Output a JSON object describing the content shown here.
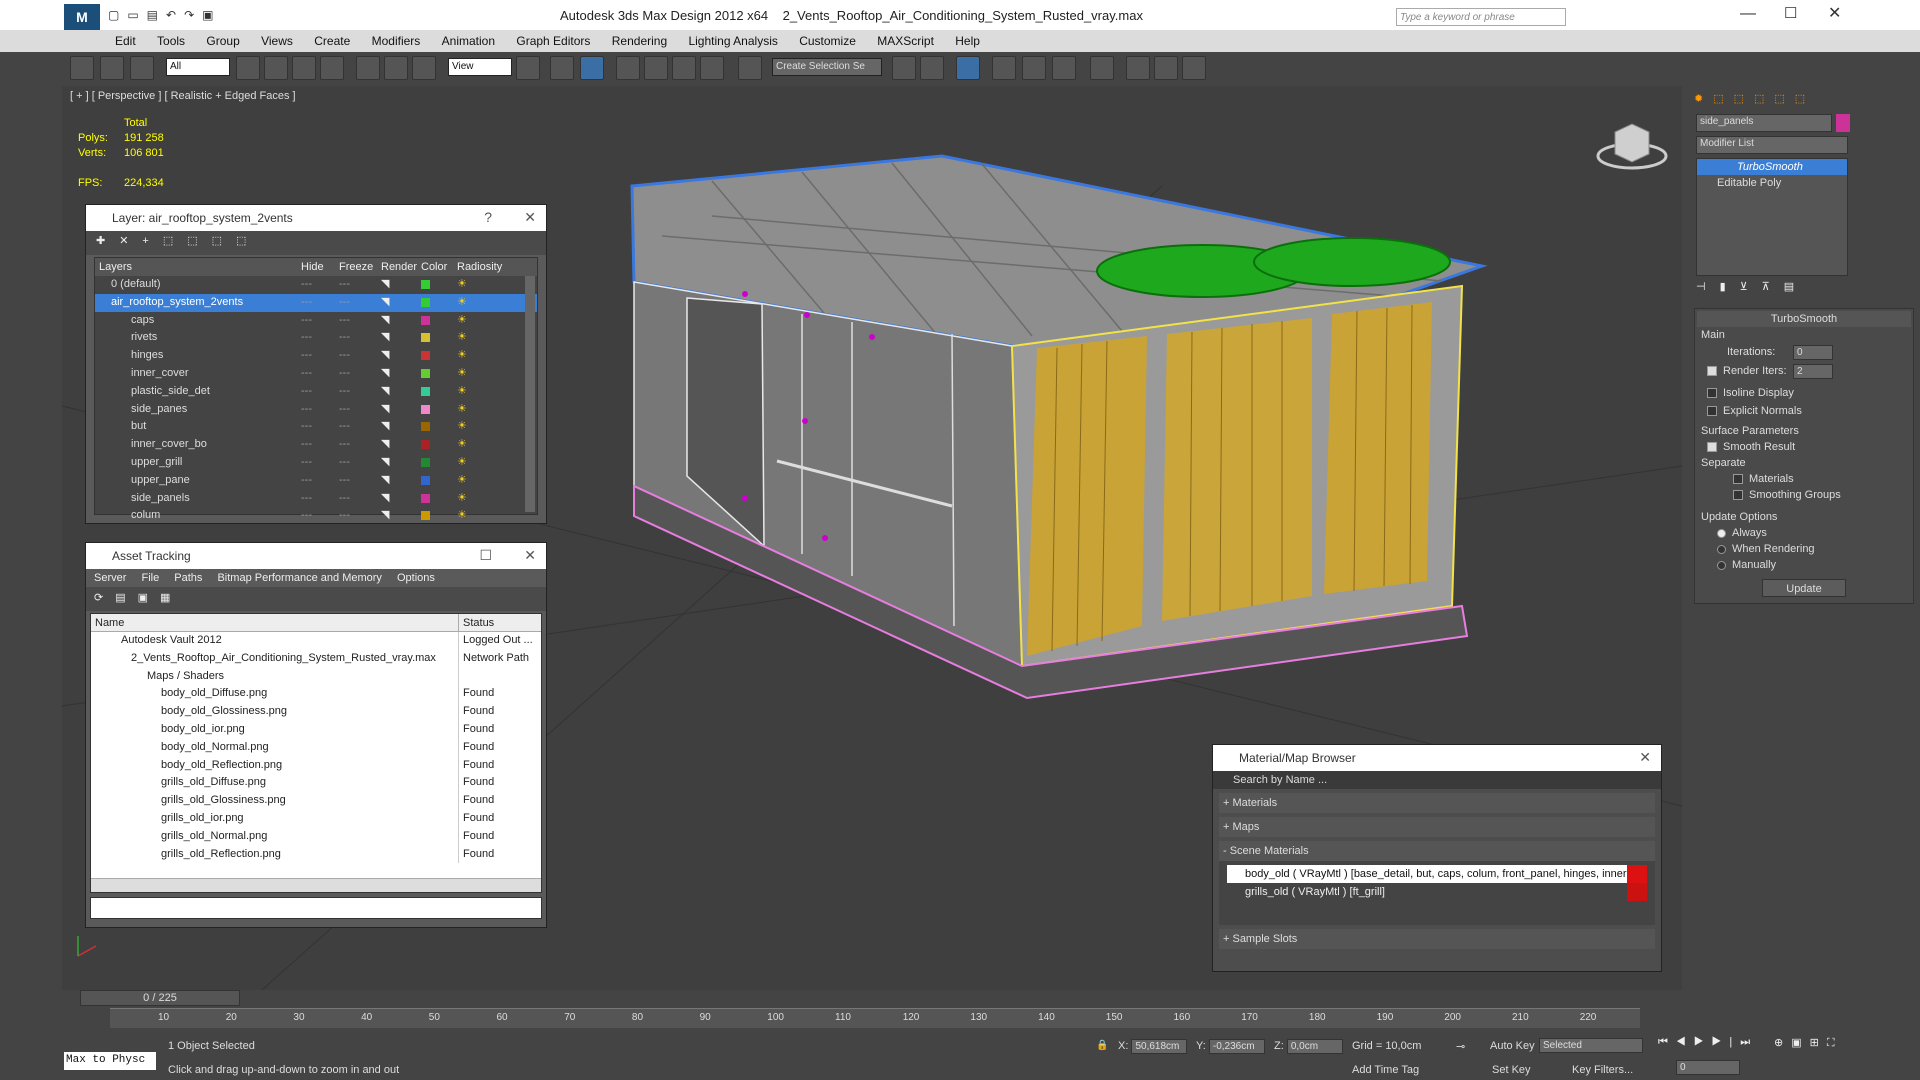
{
  "app": {
    "title": "Autodesk 3ds Max Design 2012 x64",
    "file": "2_Vents_Rooftop_Air_Conditioning_System_Rusted_vray.max",
    "search_placeholder": "Type a keyword or phrase"
  },
  "menu": [
    "Edit",
    "Tools",
    "Group",
    "Views",
    "Create",
    "Modifiers",
    "Animation",
    "Graph Editors",
    "Rendering",
    "Lighting Analysis",
    "Customize",
    "MAXScript",
    "Help"
  ],
  "toolbar": {
    "selection_filter": "All",
    "ref_coord": "View",
    "named_selection": "Create Selection Se"
  },
  "viewport": {
    "label": "[ + ] [ Perspective ] [ Realistic + Edged Faces ]",
    "stats": {
      "total_label": "Total",
      "polys_label": "Polys:",
      "polys": "191 258",
      "verts_label": "Verts:",
      "verts": "106 801",
      "fps_label": "FPS:",
      "fps": "224,334"
    }
  },
  "layer_panel": {
    "title": "Layer: air_rooftop_system_2vents",
    "columns": [
      "Layers",
      "Hide",
      "Freeze",
      "Render",
      "Color",
      "Radiosity"
    ],
    "rows": [
      {
        "name": "0 (default)",
        "color": "#33cc33"
      },
      {
        "name": "air_rooftop_system_2vents",
        "color": "#33cc33",
        "selected": true
      },
      {
        "name": "caps",
        "color": "#cc3399"
      },
      {
        "name": "rivets",
        "color": "#d4c030"
      },
      {
        "name": "hinges",
        "color": "#cc3333"
      },
      {
        "name": "inner_cover",
        "color": "#66cc33"
      },
      {
        "name": "plastic_side_det",
        "color": "#33cc99"
      },
      {
        "name": "side_panes",
        "color": "#ee88cc"
      },
      {
        "name": "but",
        "color": "#996600"
      },
      {
        "name": "inner_cover_bo",
        "color": "#aa2222"
      },
      {
        "name": "upper_grill",
        "color": "#228833"
      },
      {
        "name": "upper_pane",
        "color": "#3366cc"
      },
      {
        "name": "side_panels",
        "color": "#cc3399"
      },
      {
        "name": "colum",
        "color": "#cc9900"
      }
    ]
  },
  "asset_panel": {
    "title": "Asset Tracking",
    "menu": [
      "Server",
      "File",
      "Paths",
      "Bitmap Performance and Memory",
      "Options"
    ],
    "columns": [
      "Name",
      "Status"
    ],
    "rows": [
      {
        "name": "Autodesk Vault 2012",
        "status": "Logged Out ...",
        "indent": 1
      },
      {
        "name": "2_Vents_Rooftop_Air_Conditioning_System_Rusted_vray.max",
        "status": "Network Path",
        "indent": 2
      },
      {
        "name": "Maps / Shaders",
        "status": "",
        "indent": 3
      },
      {
        "name": "body_old_Diffuse.png",
        "status": "Found",
        "indent": 4
      },
      {
        "name": "body_old_Glossiness.png",
        "status": "Found",
        "indent": 4
      },
      {
        "name": "body_old_ior.png",
        "status": "Found",
        "indent": 4
      },
      {
        "name": "body_old_Normal.png",
        "status": "Found",
        "indent": 4
      },
      {
        "name": "body_old_Reflection.png",
        "status": "Found",
        "indent": 4
      },
      {
        "name": "grills_old_Diffuse.png",
        "status": "Found",
        "indent": 4
      },
      {
        "name": "grills_old_Glossiness.png",
        "status": "Found",
        "indent": 4
      },
      {
        "name": "grills_old_ior.png",
        "status": "Found",
        "indent": 4
      },
      {
        "name": "grills_old_Normal.png",
        "status": "Found",
        "indent": 4
      },
      {
        "name": "grills_old_Reflection.png",
        "status": "Found",
        "indent": 4
      }
    ]
  },
  "material_browser": {
    "title": "Material/Map Browser",
    "search_placeholder": "Search by Name ...",
    "sections": [
      "+ Materials",
      "+ Maps",
      "- Scene Materials",
      "+ Sample Slots"
    ],
    "scene_materials": [
      "body_old  ( VRayMtl ) [base_detail, but, caps, colum, front_panel, hinges, inner...",
      "grills_old  ( VRayMtl ) [ft_grill]"
    ]
  },
  "command_panel": {
    "object_name": "side_panels",
    "object_color": "#cc3399",
    "modifier_list": "Modifier List",
    "stack": [
      "TurboSmooth",
      "Editable Poly"
    ],
    "rollout_title": "TurboSmooth",
    "main_label": "Main",
    "iterations_label": "Iterations:",
    "iterations": "0",
    "render_iters_label": "Render Iters:",
    "render_iters": "2",
    "isoline": "Isoline Display",
    "explicit_normals": "Explicit Normals",
    "surface_params": "Surface Parameters",
    "smooth_result": "Smooth Result",
    "separate": "Separate",
    "materials": "Materials",
    "smoothing_groups": "Smoothing Groups",
    "update_options": "Update Options",
    "always": "Always",
    "when_rendering": "When Rendering",
    "manually": "Manually",
    "update_btn": "Update"
  },
  "timeline": {
    "frame": "0 / 225",
    "ticks": [
      "10",
      "20",
      "30",
      "40",
      "50",
      "60",
      "70",
      "80",
      "90",
      "100",
      "110",
      "120",
      "130",
      "140",
      "150",
      "160",
      "170",
      "180",
      "190",
      "200",
      "210",
      "220"
    ]
  },
  "status": {
    "script_label": "Max to Physc",
    "selected": "1 Object Selected",
    "hint": "Click and drag up-and-down to zoom in and out",
    "x_label": "X:",
    "x": "50,618cm",
    "y_label": "Y:",
    "y": "-0,236cm",
    "z_label": "Z:",
    "z": "0,0cm",
    "grid": "Grid = 10,0cm",
    "add_time_tag": "Add Time Tag",
    "auto_key": "Auto Key",
    "auto_key_value": "Selected",
    "set_key": "Set Key",
    "key_filters": "Key Filters...",
    "frame_value": "0"
  }
}
